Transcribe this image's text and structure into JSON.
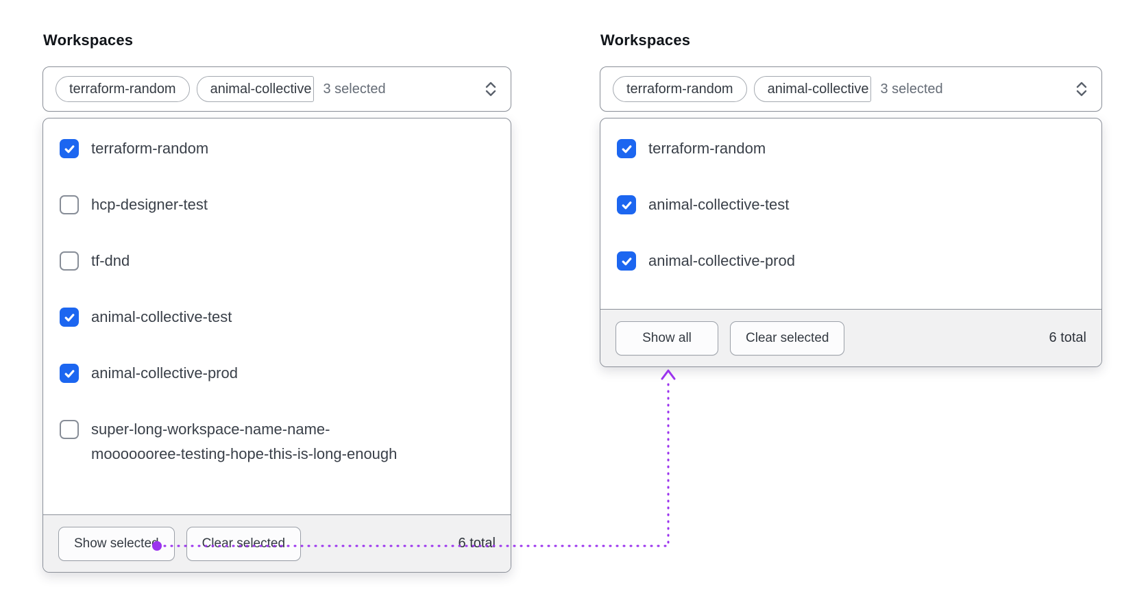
{
  "colors": {
    "checkbox_blue": "#1c66f0",
    "annotation_purple": "#9b33ee",
    "panel_border": "#8a8f98",
    "footer_bg": "#f1f1f2"
  },
  "left_panel": {
    "label": "Workspaces",
    "trigger": {
      "pills": [
        "terraform-random",
        "animal-collective"
      ],
      "selected_count_text": "3 selected"
    },
    "options": [
      {
        "label": "terraform-random",
        "checked": true
      },
      {
        "label": "hcp-designer-test",
        "checked": false
      },
      {
        "label": "tf-dnd",
        "checked": false
      },
      {
        "label": "animal-collective-test",
        "checked": true
      },
      {
        "label": "animal-collective-prod",
        "checked": true
      },
      {
        "label": "super-long-workspace-name-name-",
        "label2": "mooooooree-testing-hope-this-is-long-enough",
        "checked": false
      }
    ],
    "footer": {
      "primary_button": "Show selected",
      "secondary_button": "Clear selected",
      "total_text": "6 total"
    }
  },
  "right_panel": {
    "label": "Workspaces",
    "trigger": {
      "pills": [
        "terraform-random",
        "animal-collective"
      ],
      "selected_count_text": "3 selected"
    },
    "options": [
      {
        "label": "terraform-random",
        "checked": true
      },
      {
        "label": "animal-collective-test",
        "checked": true
      },
      {
        "label": "animal-collective-prod",
        "checked": true
      }
    ],
    "footer": {
      "primary_button": "Show all",
      "secondary_button": "Clear selected",
      "total_text": "6 total"
    }
  }
}
